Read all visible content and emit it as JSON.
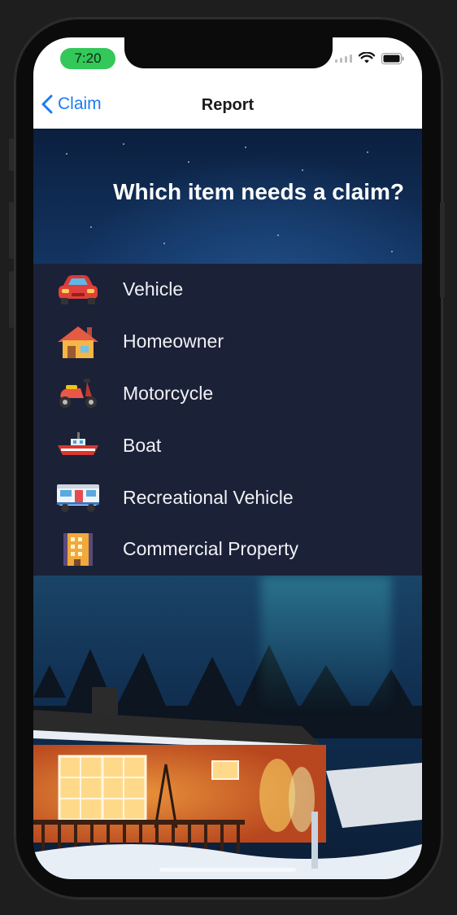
{
  "status_bar": {
    "time": "7:20"
  },
  "nav": {
    "back_label": "Claim",
    "title": "Report"
  },
  "question": "Which item needs a claim?",
  "options": [
    {
      "label": "Vehicle",
      "icon": "car-icon"
    },
    {
      "label": "Homeowner",
      "icon": "house-icon"
    },
    {
      "label": "Motorcycle",
      "icon": "scooter-icon"
    },
    {
      "label": "Boat",
      "icon": "boat-icon"
    },
    {
      "label": "Recreational Vehicle",
      "icon": "rv-icon"
    },
    {
      "label": "Commercial Property",
      "icon": "building-icon"
    }
  ],
  "colors": {
    "accent": "#1a7cf2",
    "status_time_bg": "#34c759",
    "list_bg": "#1b2137",
    "list_text": "#f0f1f5"
  }
}
